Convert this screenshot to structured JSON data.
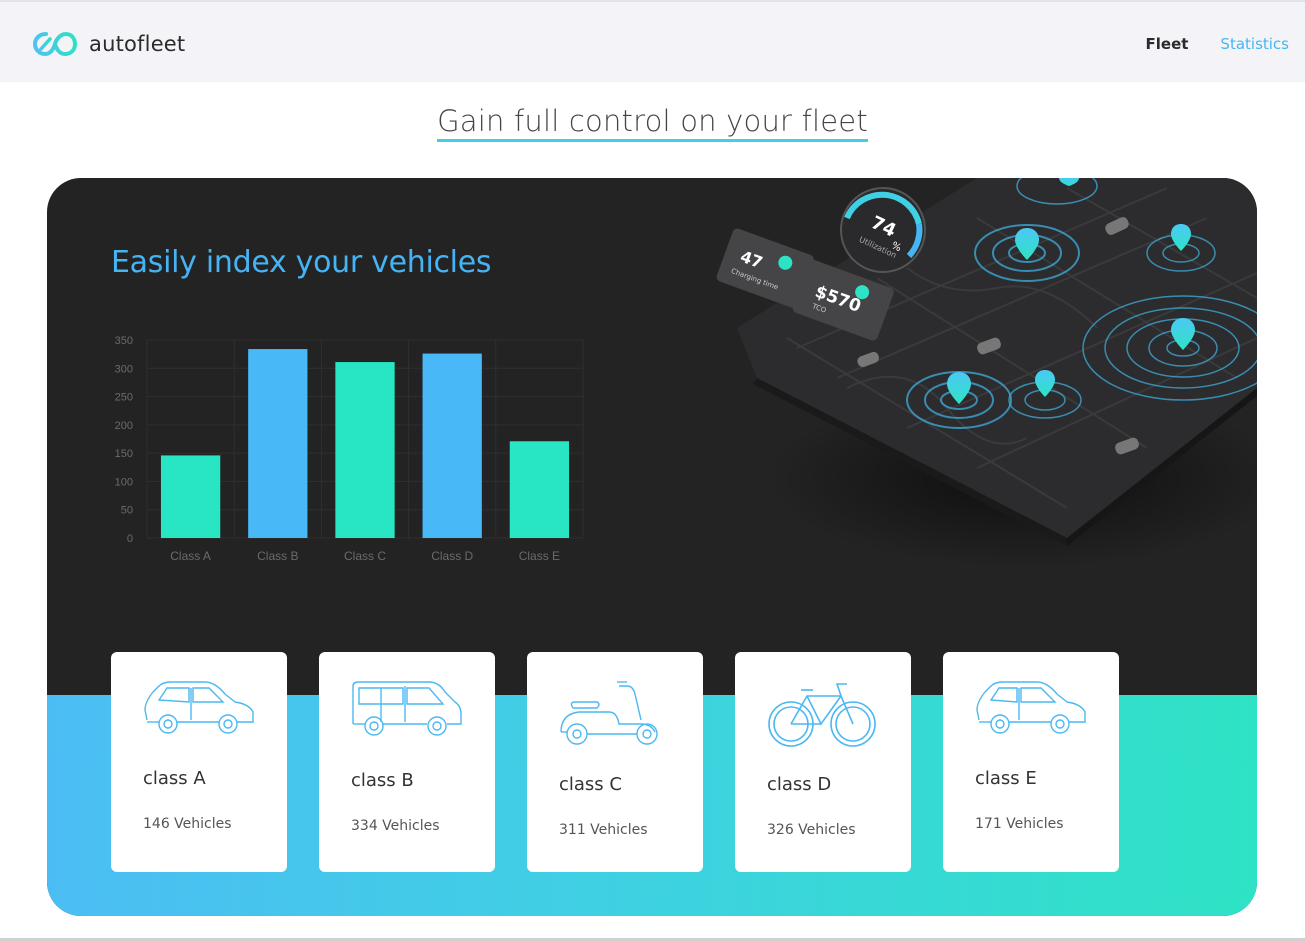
{
  "header": {
    "brand": "autofleet",
    "nav": [
      {
        "label": "Fleet"
      },
      {
        "label": "Statistics"
      }
    ]
  },
  "hero": {
    "title": "Gain full control on your fleet"
  },
  "panel": {
    "heading": "Easily index your vehicles"
  },
  "map_widgets": {
    "utilization_value": "74",
    "utilization_unit": "%",
    "utilization_label": "Utilization",
    "charging_value": "47",
    "charging_label": "Charging time",
    "tco_value": "$570",
    "tco_label": "TCO"
  },
  "chart_data": {
    "type": "bar",
    "categories": [
      "Class A",
      "Class B",
      "Class C",
      "Class D",
      "Class E"
    ],
    "values": [
      146,
      334,
      311,
      326,
      171
    ],
    "colors": [
      "#28e5c3",
      "#48b8f6",
      "#28e5c3",
      "#48b8f6",
      "#28e5c3"
    ],
    "ylim": [
      0,
      350
    ],
    "yticks": [
      0,
      50,
      100,
      150,
      200,
      250,
      300,
      350
    ],
    "grid": true
  },
  "classes": [
    {
      "name": "class A",
      "count": "146 Vehicles",
      "icon": "hatchback-car-icon"
    },
    {
      "name": "class B",
      "count": "334 Vehicles",
      "icon": "van-icon"
    },
    {
      "name": "class C",
      "count": "311 Vehicles",
      "icon": "scooter-icon"
    },
    {
      "name": "class D",
      "count": "326 Vehicles",
      "icon": "bicycle-icon"
    },
    {
      "name": "class E",
      "count": "171 Vehicles",
      "icon": "compact-car-icon"
    }
  ],
  "colors": {
    "accent_blue": "#46b6f2",
    "accent_teal": "#2ee3c5",
    "panel_dark": "#232323"
  }
}
